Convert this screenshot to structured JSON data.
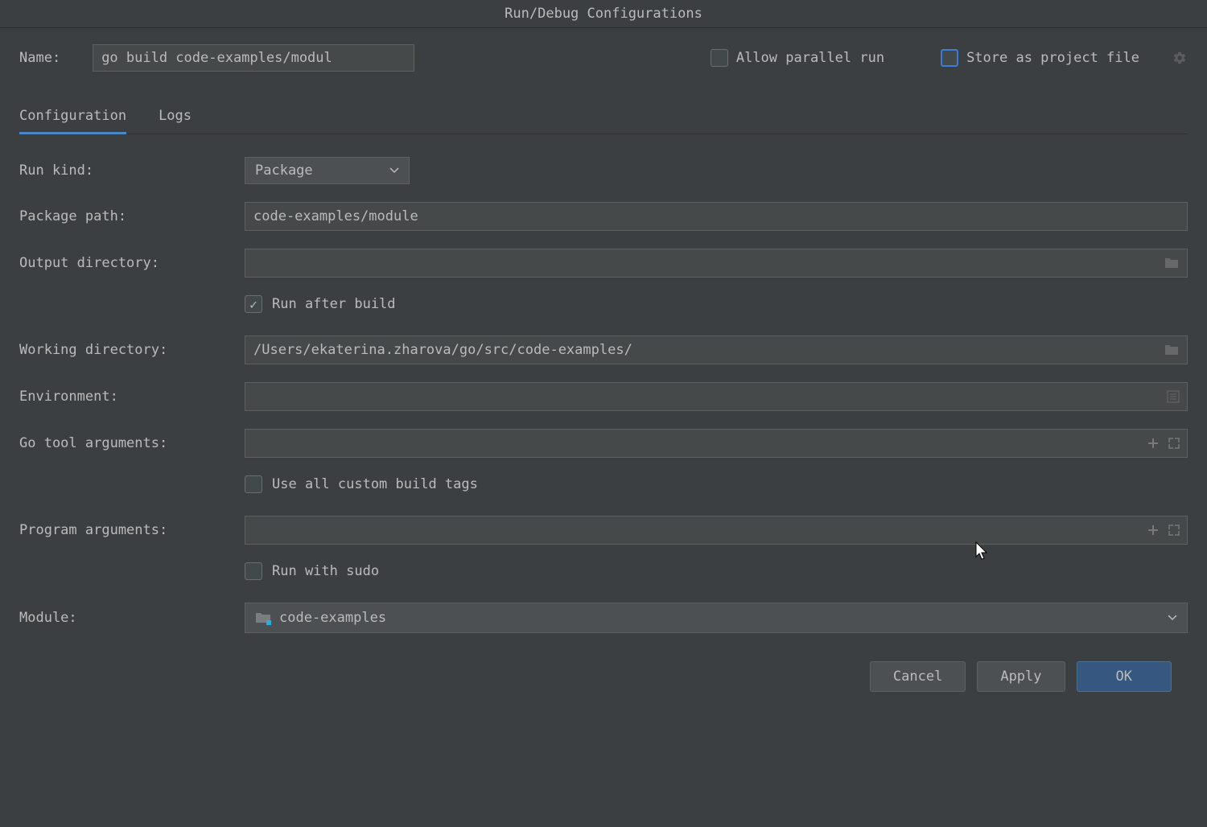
{
  "window": {
    "title": "Run/Debug Configurations"
  },
  "name": {
    "label": "Name:",
    "value": "go build code-examples/modul"
  },
  "options": {
    "allow_parallel_label": "Allow parallel run",
    "allow_parallel_checked": false,
    "store_project_label": "Store as project file",
    "store_project_checked": false
  },
  "tabs": [
    {
      "label": "Configuration",
      "active": true
    },
    {
      "label": "Logs",
      "active": false
    }
  ],
  "form": {
    "run_kind_label": "Run kind:",
    "run_kind_value": "Package",
    "package_path_label": "Package path:",
    "package_path_value": "code-examples/module",
    "output_dir_label": "Output directory:",
    "output_dir_value": "",
    "run_after_build_label": "Run after build",
    "run_after_build_checked": true,
    "working_dir_label": "Working directory:",
    "working_dir_value": "/Users/ekaterina.zharova/go/src/code-examples/",
    "environment_label": "Environment:",
    "environment_value": "",
    "go_tool_args_label": "Go tool arguments:",
    "go_tool_args_value": "",
    "use_custom_tags_label": "Use all custom build tags",
    "use_custom_tags_checked": false,
    "program_args_label": "Program arguments:",
    "program_args_value": "",
    "run_sudo_label": "Run with sudo",
    "run_sudo_checked": false,
    "module_label": "Module:",
    "module_value": "code-examples"
  },
  "buttons": {
    "cancel": "Cancel",
    "apply": "Apply",
    "ok": "OK"
  }
}
